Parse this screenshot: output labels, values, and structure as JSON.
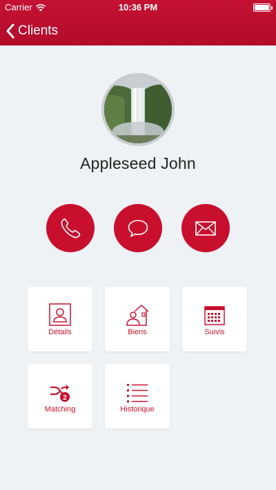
{
  "status": {
    "carrier": "Carrier",
    "time": "10:36 PM"
  },
  "nav": {
    "back_label": "Clients"
  },
  "profile": {
    "name": "Appleseed John"
  },
  "actions": [
    {
      "icon": "phone-icon"
    },
    {
      "icon": "chat-bubble-icon"
    },
    {
      "icon": "envelope-icon"
    }
  ],
  "tiles": [
    {
      "label": "Détails",
      "icon": "contact-card-icon"
    },
    {
      "label": "Biens",
      "icon": "house-person-icon"
    },
    {
      "label": "Suivis",
      "icon": "calendar-icon"
    },
    {
      "label": "Matching",
      "icon": "shuffle-icon",
      "badge": "2"
    },
    {
      "label": "Historique",
      "icon": "list-icon"
    }
  ],
  "colors": {
    "brand": "#c8102e",
    "background": "#eef2f5",
    "tile": "#ffffff"
  }
}
